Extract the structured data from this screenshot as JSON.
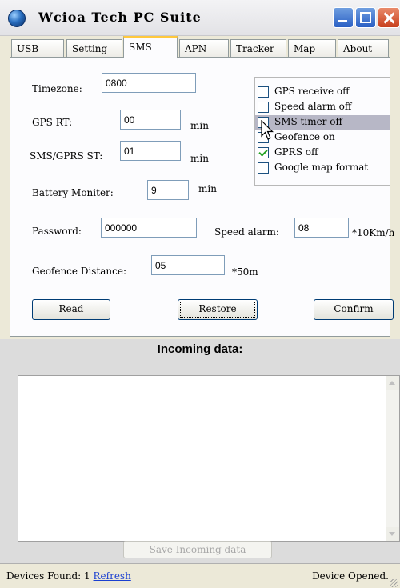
{
  "window": {
    "title": "Wcioa Tech PC Suite"
  },
  "tabs": [
    {
      "label": "USB"
    },
    {
      "label": "Setting"
    },
    {
      "label": "SMS"
    },
    {
      "label": "APN"
    },
    {
      "label": "Tracker"
    },
    {
      "label": "Map"
    },
    {
      "label": "About"
    }
  ],
  "active_tab": "SMS",
  "fields": {
    "timezone_label": "Timezone:",
    "timezone_value": "0800",
    "gps_rt_label": "GPS RT:",
    "gps_rt_value": "00",
    "gps_rt_unit": "min",
    "sms_gprs_label": "SMS/GPRS ST:",
    "sms_gprs_value": "01",
    "sms_gprs_unit": "min",
    "battery_label": "Battery Moniter:",
    "battery_value": "9",
    "battery_unit": "min",
    "password_label": "Password:",
    "password_value": "000000",
    "speed_alarm_label": "Speed alarm:",
    "speed_alarm_value": "08",
    "speed_alarm_unit": "*10Km/h",
    "geofence_label": "Geofence Distance:",
    "geofence_value": "05",
    "geofence_unit": "*50m"
  },
  "options": [
    {
      "label": "GPS receive off",
      "checked": false,
      "highlighted": false
    },
    {
      "label": "Speed alarm off",
      "checked": false,
      "highlighted": false
    },
    {
      "label": "SMS timer off",
      "checked": false,
      "highlighted": true
    },
    {
      "label": "Geofence on",
      "checked": false,
      "highlighted": false
    },
    {
      "label": "GPRS off",
      "checked": true,
      "highlighted": false
    },
    {
      "label": "Google map format",
      "checked": false,
      "highlighted": false
    }
  ],
  "buttons": {
    "read": "Read",
    "restore": "Restore",
    "confirm": "Confirm"
  },
  "incoming": {
    "title": "Incoming data:",
    "content": "",
    "save_label": "Save Incoming data"
  },
  "status": {
    "devices_found": "Devices Found: 1",
    "refresh": "Refresh",
    "device_state": "Device Opened."
  }
}
